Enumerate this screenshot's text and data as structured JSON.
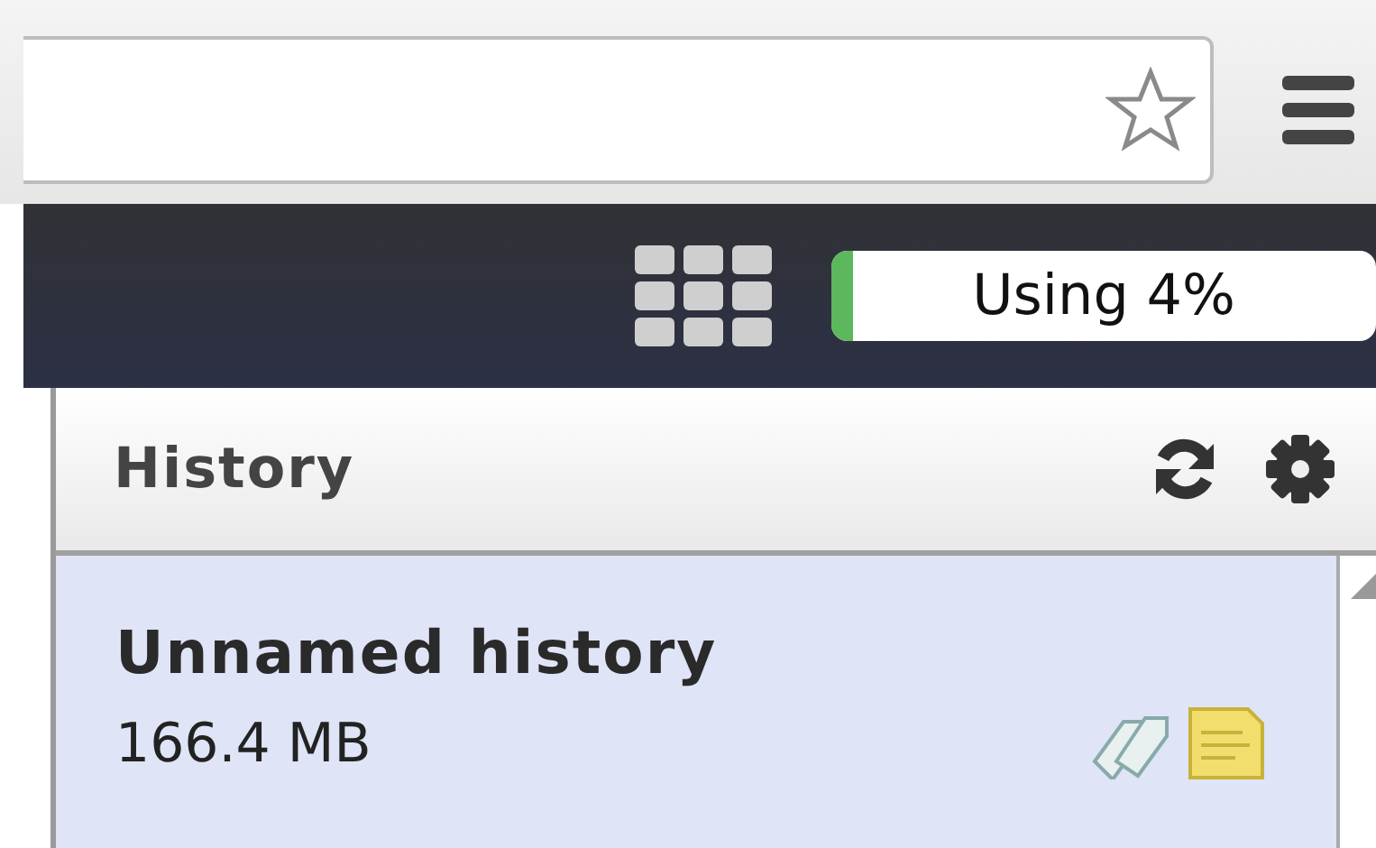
{
  "navbar": {
    "usage": {
      "label": "Using 4%",
      "level": 0.04
    }
  },
  "history_panel": {
    "title": "History",
    "current_history": {
      "name": "Unnamed history",
      "size": "166.4 MB"
    }
  }
}
